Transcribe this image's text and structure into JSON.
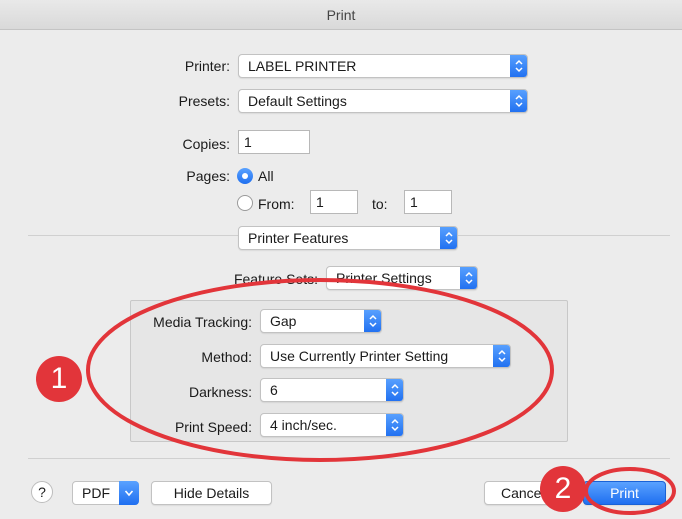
{
  "window": {
    "title": "Print"
  },
  "printer": {
    "label": "Printer:",
    "value": "LABEL PRINTER"
  },
  "presets": {
    "label": "Presets:",
    "value": "Default Settings"
  },
  "copies": {
    "label": "Copies:",
    "value": "1"
  },
  "pages": {
    "label": "Pages:",
    "all_label": "All",
    "from_label": "From:",
    "from_value": "1",
    "to_label": "to:",
    "to_value": "1",
    "selected": "All"
  },
  "section": {
    "value": "Printer Features"
  },
  "feature_sets": {
    "label": "Feature Sets:",
    "value": "Printer Settings"
  },
  "settings": {
    "media_tracking": {
      "label": "Media Tracking:",
      "value": "Gap"
    },
    "method": {
      "label": "Method:",
      "value": "Use Currently Printer Setting"
    },
    "darkness": {
      "label": "Darkness:",
      "value": "6"
    },
    "print_speed": {
      "label": "Print Speed:",
      "value": "4 inch/sec."
    }
  },
  "footer": {
    "help": "?",
    "pdf": "PDF",
    "hide_details": "Hide Details",
    "cancel": "Cancel",
    "print": "Print"
  },
  "annotations": {
    "badge_1": "1",
    "badge_2": "2",
    "color": "#e2353a"
  },
  "colors": {
    "accent": "#1f6ff0",
    "background": "#ececec"
  }
}
